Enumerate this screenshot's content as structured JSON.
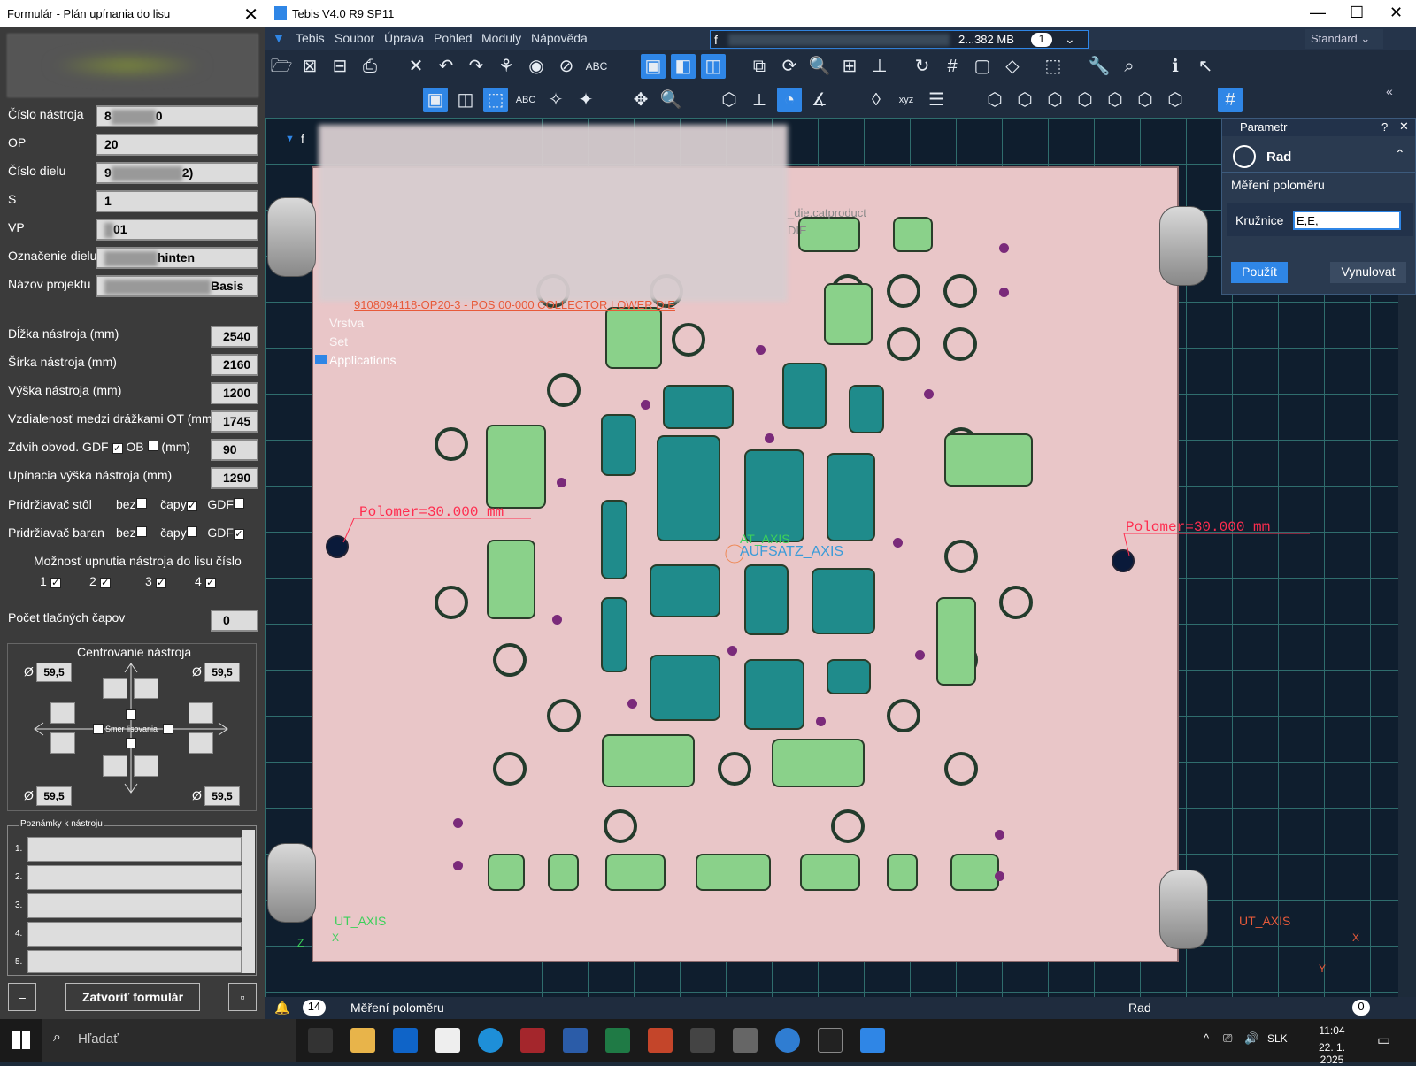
{
  "form": {
    "title": "Formulár - Plán upínania do lisu",
    "fields": [
      {
        "label": "Číslo nástroja",
        "value_prefix": "8",
        "value_suffix": "0"
      },
      {
        "label": "OP",
        "value_prefix": "20",
        "value_suffix": ""
      },
      {
        "label": "Číslo dielu",
        "value_prefix": "9",
        "value_suffix": "2)"
      },
      {
        "label": "S",
        "value_prefix": "1",
        "value_suffix": ""
      },
      {
        "label": "VP",
        "value_prefix": "",
        "value_suffix": "01"
      },
      {
        "label": "Označenie dielu",
        "value_prefix": "",
        "value_suffix": "hinten"
      },
      {
        "label": "Názov projektu",
        "value_prefix": "",
        "value_suffix": "Basis"
      }
    ],
    "dims": [
      {
        "label": "Dĺžka nástroja (mm)",
        "value": "2540"
      },
      {
        "label": "Šírka nástroja (mm)",
        "value": "2160"
      },
      {
        "label": "Výška nástroja (mm)",
        "value": "1200"
      },
      {
        "label": "Vzdialenosť medzi drážkami OT (mm)",
        "value": "1745"
      }
    ],
    "stroke_label": "Zdvih obvod. GDF",
    "stroke_ob": "OB",
    "stroke_unit": "(mm)",
    "stroke_value": "90",
    "clamp_height_label": "Upínacia výška nástroja (mm)",
    "clamp_height_value": "1290",
    "holder_table": "Pridržiavač stôl",
    "holder_ram": "Pridržiavač baran",
    "opt_bez": "bez",
    "opt_capy": "čapy",
    "opt_gdf": "GDF",
    "press_option_title": "Možnosť upnutia nástroja do lisu číslo",
    "press_numbers": [
      "1",
      "2",
      "3",
      "4"
    ],
    "pin_count_label": "Počet tlačných čapov",
    "pin_count_value": "0",
    "centering_title": "Centrovanie nástroja",
    "diameter_symbol": "Ø",
    "diameter_value": "59,5",
    "press_direction": "Smer lisovania",
    "notes_title": "Poznámky k nástroju",
    "note_numbers": [
      "1.",
      "2.",
      "3.",
      "4.",
      "5."
    ],
    "minimize_label": "–",
    "close_button": "Zatvoriť formulár",
    "restore_label": "▫"
  },
  "window": {
    "title": "Tebis V4.0 R9 SP11",
    "menus": [
      "Tebis",
      "Soubor",
      "Úprava",
      "Pohled",
      "Moduly",
      "Nápověda"
    ],
    "file_field": "f",
    "memory": "2...382 MB",
    "window_count": "1",
    "profile": "Standard"
  },
  "tree": {
    "root": "f",
    "file_hint": "_die.catproduct",
    "file_hint2": "DIE",
    "part_line": "9108094118-OP20-3 - POS 00-000 COLLECTOR LOWER DIE",
    "items": [
      "Vrstva",
      "Set",
      "Applications"
    ]
  },
  "viewport": {
    "measure_left": "Polomer=30.000 mm",
    "measure_right": "Polomer=30.000 mm",
    "axis_labels": [
      "AT_AXIS",
      "AUFSATZ_AXIS"
    ],
    "ut_axis": "UT_AXIS",
    "x": "X",
    "y": "Y",
    "z": "Z"
  },
  "param_panel": {
    "title": "Parametr",
    "help": "?",
    "close": "✕",
    "function": "Rad",
    "subtitle": "Měření poloměru",
    "field_label": "Kružnice",
    "field_value": "E,E,",
    "apply": "Použít",
    "reset": "Vynulovat"
  },
  "status": {
    "count": "14",
    "message": "Měření poloměru",
    "mode": "Rad",
    "right_count": "0"
  },
  "taskbar": {
    "search_placeholder": "Hľadať",
    "lang": "SLK",
    "time": "11:04",
    "date": "22. 1. 2025"
  }
}
